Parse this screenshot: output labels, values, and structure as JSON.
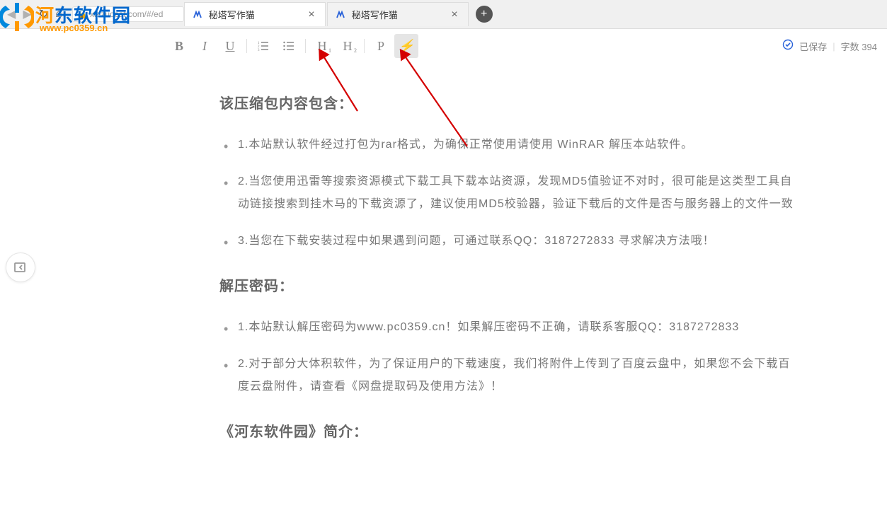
{
  "browser": {
    "url": "xiezuocat.com/#/ed"
  },
  "tabs": [
    {
      "title": "秘塔写作猫",
      "active": true
    },
    {
      "title": "秘塔写作猫",
      "active": false
    }
  ],
  "watermark": {
    "brand_cn": "河东软件园",
    "brand_url": "www.pc0359.cn"
  },
  "status": {
    "saved_label": "已保存",
    "wordcount_prefix": "字数",
    "wordcount": "394"
  },
  "document": {
    "h1": "该压缩包内容包含：",
    "list1": [
      "1.本站默认软件经过打包为rar格式，为确保正常使用请使用 WinRAR 解压本站软件。",
      "2.当您使用迅雷等搜索资源模式下载工具下载本站资源，发现MD5值验证不对时，很可能是这类型工具自动链接搜索到挂木马的下载资源了，建议使用MD5校验器，验证下载后的文件是否与服务器上的文件一致",
      "3.当您在下载安装过程中如果遇到问题，可通过联系QQ：3187272833 寻求解决方法哦！"
    ],
    "h2": "解压密码：",
    "list2": [
      "1.本站默认解压密码为www.pc0359.cn！如果解压密码不正确，请联系客服QQ：3187272833",
      "2.对于部分大体积软件，为了保证用户的下载速度，我们将附件上传到了百度云盘中，如果您不会下载百度云盘附件，请查看《网盘提取码及使用方法》！"
    ],
    "h3": "《河东软件园》简介："
  }
}
